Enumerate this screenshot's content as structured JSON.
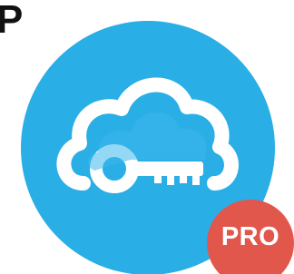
{
  "header": {
    "partial_title": "P"
  },
  "app_icon": {
    "icon_name": "cloud-key-icon",
    "badge_label": "PRO"
  },
  "colors": {
    "circle_blue": "#2aaee6",
    "cloud_white": "#ffffff",
    "badge_red": "#e2574c",
    "text_dark": "#111111"
  }
}
